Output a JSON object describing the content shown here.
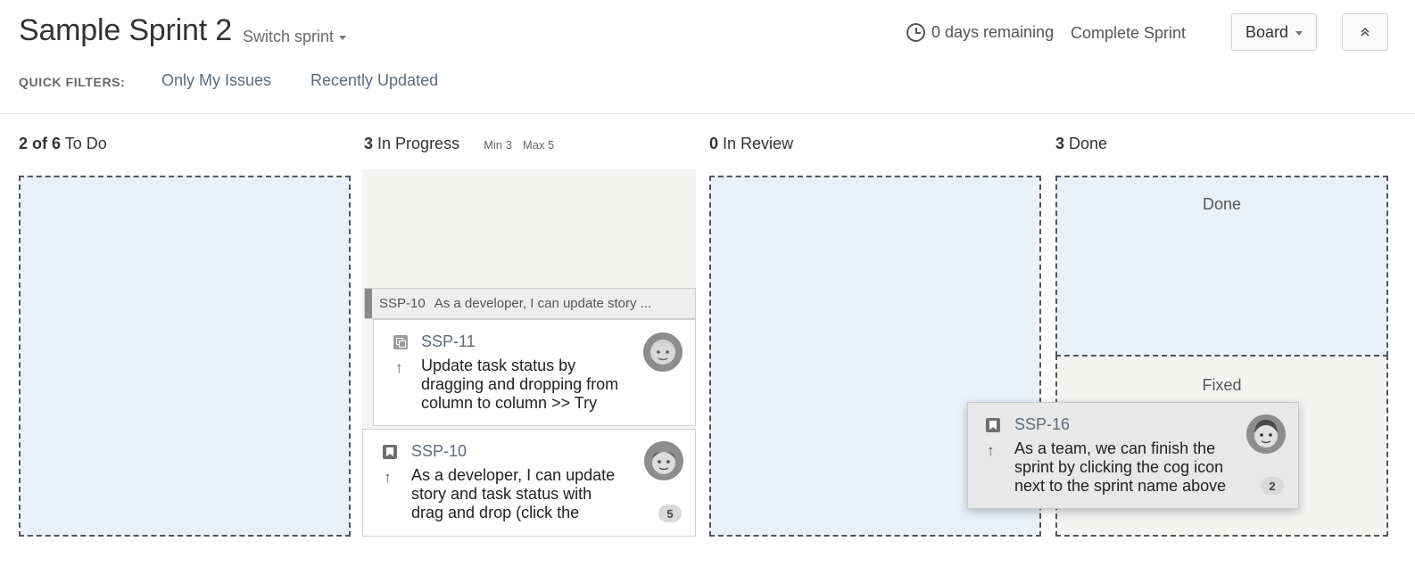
{
  "header": {
    "sprint_title": "Sample Sprint 2",
    "switch_sprint": "Switch sprint",
    "days_remaining": "0 days remaining",
    "complete_sprint": "Complete Sprint",
    "board_button": "Board"
  },
  "quick_filters": {
    "label": "QUICK FILTERS:",
    "items": [
      "Only My Issues",
      "Recently Updated"
    ]
  },
  "columns": [
    {
      "count": "2 of 6",
      "name": "To Do"
    },
    {
      "count": "3",
      "name": "In Progress",
      "min": "Min 3",
      "max": "Max 5"
    },
    {
      "count": "0",
      "name": "In Review"
    },
    {
      "count": "3",
      "name": "Done"
    }
  ],
  "done_zones": [
    "Done",
    "Fixed"
  ],
  "swimlane": {
    "key": "SSP-10",
    "summary": "As a developer, I can update story ..."
  },
  "cards": [
    {
      "key": "SSP-11",
      "type_icon": "subtask-icon",
      "priority_icon": "arrow-up-icon",
      "summary_lines": [
        "Update task status by",
        "dragging and dropping from",
        "column to column >> Try"
      ]
    },
    {
      "key": "SSP-10",
      "type_icon": "story-icon",
      "priority_icon": "arrow-up-icon",
      "summary_lines": [
        "As a developer, I can update",
        "story and task status with",
        "drag and drop (click the"
      ],
      "badge": "5"
    },
    {
      "key": "SSP-16",
      "type_icon": "story-icon",
      "priority_icon": "arrow-up-icon",
      "summary_lines": [
        "As a team, we can finish the",
        "sprint by clicking the cog icon",
        "next to the sprint name above"
      ],
      "badge": "2"
    }
  ],
  "colors": {
    "drop_zone": "#eaf1fb",
    "key_text": "#5f6b78",
    "dashed_border": "#555555"
  }
}
